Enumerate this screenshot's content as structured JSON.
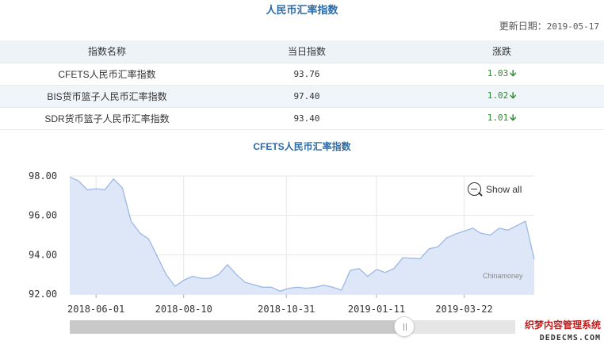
{
  "page": {
    "title": "人民币汇率指数",
    "update_label": "更新日期：",
    "update_date": "2019-05-17"
  },
  "table": {
    "headers": [
      "指数名称",
      "当日指数",
      "涨跌"
    ],
    "rows": [
      {
        "name": "CFETS人民币汇率指数",
        "value": "93.76",
        "change": "1.03",
        "direction": "down"
      },
      {
        "name": "BIS货币篮子人民币汇率指数",
        "value": "97.40",
        "change": "1.02",
        "direction": "down"
      },
      {
        "name": "SDR货币篮子人民币汇率指数",
        "value": "93.40",
        "change": "1.01",
        "direction": "down"
      }
    ],
    "arrow_glyph": "🡫"
  },
  "chart": {
    "title": "CFETS人民币汇率指数",
    "show_all_label": "Show all",
    "source_label": "Chinamoney"
  },
  "watermark": {
    "cn": "织梦内容管理系统",
    "en": "DEDECMS.COM"
  },
  "colors": {
    "title_blue": "#2c6ba6",
    "series_line": "#9cb8e6",
    "series_fill": "#dde7f7",
    "up_down_green": "#2a8a2a"
  },
  "chart_data": {
    "type": "area",
    "title": "CFETS人民币汇率指数",
    "xlabel": "",
    "ylabel": "",
    "ylim": [
      92,
      98
    ],
    "y_ticks": [
      "92.00",
      "94.00",
      "96.00",
      "98.00"
    ],
    "x_ticks": [
      "2018-06-01",
      "2018-08-10",
      "2018-10-31",
      "2019-01-11",
      "2019-03-22"
    ],
    "grid": true,
    "x": [
      "2018-05-11",
      "2018-05-18",
      "2018-05-25",
      "2018-06-01",
      "2018-06-08",
      "2018-06-15",
      "2018-06-22",
      "2018-06-29",
      "2018-07-06",
      "2018-07-13",
      "2018-07-20",
      "2018-07-27",
      "2018-08-03",
      "2018-08-10",
      "2018-08-17",
      "2018-08-24",
      "2018-08-31",
      "2018-09-07",
      "2018-09-14",
      "2018-09-21",
      "2018-09-28",
      "2018-10-12",
      "2018-10-19",
      "2018-10-26",
      "2018-11-02",
      "2018-11-09",
      "2018-11-16",
      "2018-11-23",
      "2018-11-30",
      "2018-12-07",
      "2018-12-14",
      "2018-12-21",
      "2018-12-28",
      "2019-01-04",
      "2019-01-11",
      "2019-01-18",
      "2019-01-25",
      "2019-02-01",
      "2019-02-15",
      "2019-02-22",
      "2019-03-01",
      "2019-03-08",
      "2019-03-15",
      "2019-03-22",
      "2019-03-29",
      "2019-04-04",
      "2019-04-12",
      "2019-04-19",
      "2019-04-26",
      "2019-05-10",
      "2019-05-17"
    ],
    "series": [
      {
        "values": [
          97.95,
          97.75,
          97.3,
          97.35,
          97.3,
          97.85,
          97.4,
          95.7,
          95.1,
          94.8,
          93.9,
          93.0,
          92.4,
          92.7,
          92.9,
          92.8,
          92.8,
          93.0,
          93.5,
          93.0,
          92.6,
          92.35,
          92.35,
          92.15,
          92.3,
          92.35,
          92.3,
          92.35,
          92.45,
          92.35,
          92.2,
          93.2,
          93.3,
          92.9,
          93.25,
          93.1,
          93.3,
          93.85,
          93.8,
          94.3,
          94.4,
          94.85,
          95.05,
          95.2,
          95.35,
          95.1,
          95.0,
          95.35,
          95.25,
          95.7,
          93.76
        ]
      }
    ]
  }
}
